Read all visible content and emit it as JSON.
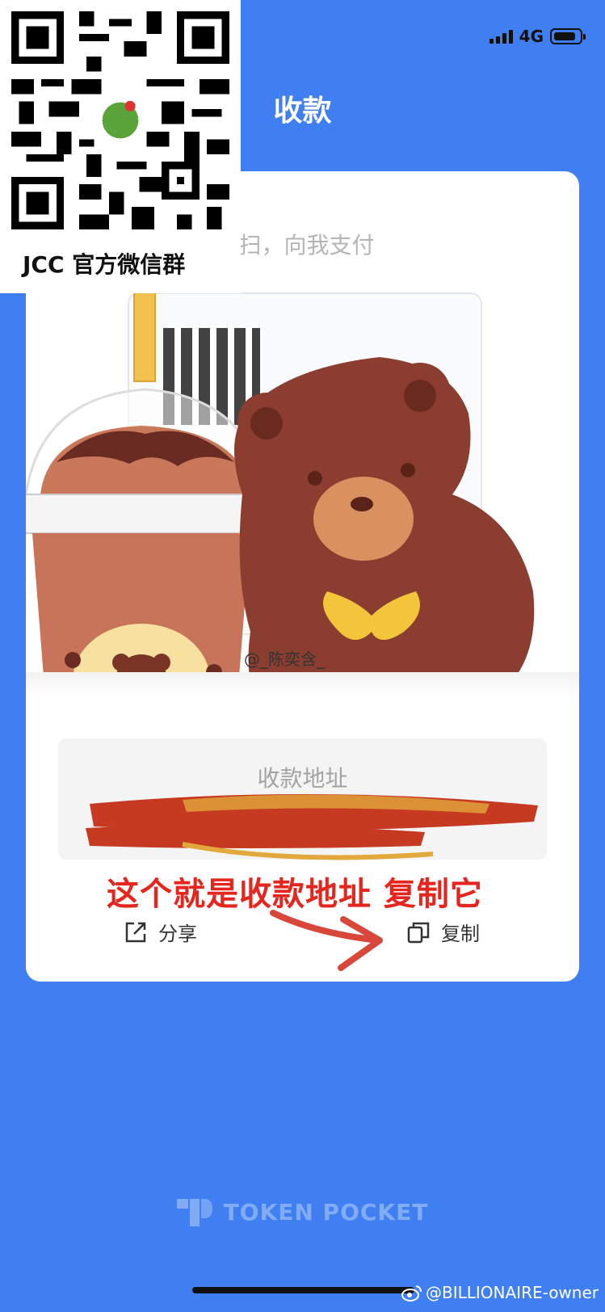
{
  "status_bar": {
    "network": "4G",
    "signal_icon": "signal-bars-icon",
    "battery_icon": "battery-icon"
  },
  "header": {
    "title": "收款"
  },
  "card": {
    "subtitle": "-扫，向我支付",
    "watermark_mid": "@_陈奕含_",
    "address_label": "收款地址",
    "annotation": "这个就是收款地址 复制它",
    "actions": [
      {
        "label": "分享",
        "icon": "share-icon"
      },
      {
        "label": "复制",
        "icon": "copy-icon"
      }
    ]
  },
  "poster": {
    "label": "JCC 官方微信群"
  },
  "brand": {
    "name": "TOKEN POCKET",
    "icon": "tokenpocket-logo-icon"
  },
  "credit": {
    "text": "@BILLIONAIRE-owner",
    "icon": "weibo-icon"
  },
  "colors": {
    "background": "#3f7ff2",
    "annotation": "#e5261e",
    "card": "#ffffff"
  }
}
